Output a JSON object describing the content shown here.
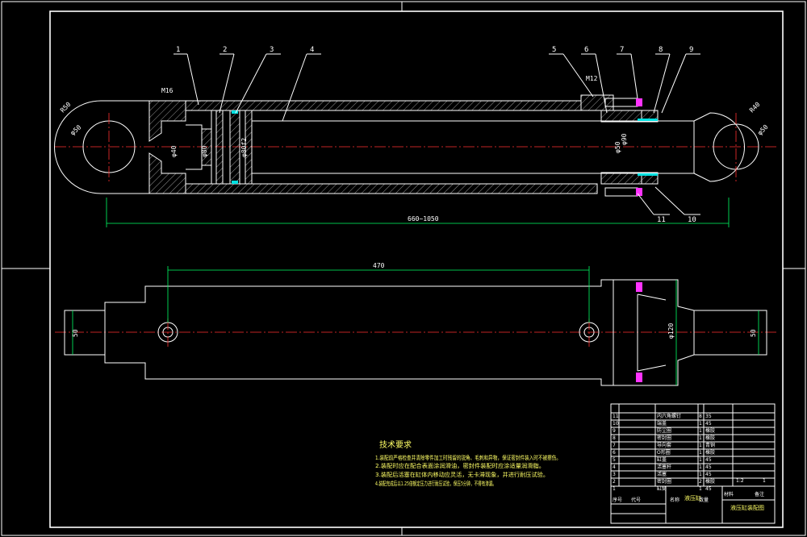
{
  "part_labels": [
    "1",
    "2",
    "3",
    "4",
    "5",
    "6",
    "7",
    "8",
    "9",
    "10",
    "11"
  ],
  "dimensions": {
    "top_length": "660~1050",
    "bottom_length": "470",
    "left_eye": "R50",
    "left_bore": "φ50",
    "right_eye": "R40",
    "right_bore": "φ50",
    "thread": "M16",
    "piston_a": "φ40",
    "piston_b": "φ80",
    "piston_c": "φ80f2",
    "rod": "φ50",
    "cap_a": "M12",
    "cap_b": "φ90",
    "flange": "φ120",
    "left_width": "50",
    "right_width": "50"
  },
  "tech_requirements": {
    "title": "技术要求",
    "items": [
      "1.装配前严格检查并清除零件加工时残留的锐角、毛刺和异物，保证密封件装入时不被擦伤。",
      "2.装配时应在配合表面涂润滑油，密封件装配时应涂适量润滑脂。",
      "3.装配后活塞在缸体内移动应灵活，无卡滞现象，并进行耐压试验。",
      "4.装配完成后以1.25倍额定压力进行耐压试验，保压5分钟，不得有渗漏。"
    ]
  },
  "title_block": {
    "rows": [
      {
        "no": "11",
        "name": "内六角螺钉",
        "qty": "8",
        "mat": "35"
      },
      {
        "no": "10",
        "name": "端盖",
        "qty": "1",
        "mat": "45"
      },
      {
        "no": "9",
        "name": "防尘圈",
        "qty": "1",
        "mat": "橡胶"
      },
      {
        "no": "8",
        "name": "密封圈",
        "qty": "1",
        "mat": "橡胶"
      },
      {
        "no": "7",
        "name": "导向套",
        "qty": "1",
        "mat": "青铜"
      },
      {
        "no": "6",
        "name": "O形圈",
        "qty": "1",
        "mat": "橡胶"
      },
      {
        "no": "5",
        "name": "缸盖",
        "qty": "1",
        "mat": "45"
      },
      {
        "no": "4",
        "name": "活塞杆",
        "qty": "1",
        "mat": "45"
      },
      {
        "no": "3",
        "name": "活塞",
        "qty": "1",
        "mat": "45"
      },
      {
        "no": "2",
        "name": "密封圈",
        "qty": "2",
        "mat": "橡胶"
      },
      {
        "no": "1",
        "name": "缸筒",
        "qty": "1",
        "mat": "45"
      }
    ],
    "header": [
      "序号",
      "代号",
      "名称",
      "数量",
      "材料",
      "备注"
    ],
    "drawing_name": "液压缸",
    "assembly": "液压缸装配图",
    "scale": "1:2",
    "sheet": "1"
  }
}
